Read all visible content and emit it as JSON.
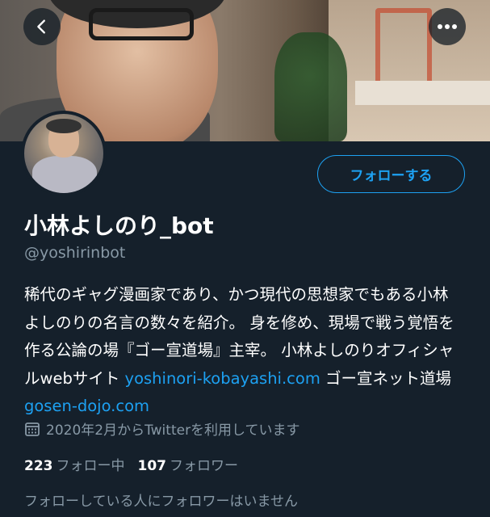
{
  "header": {
    "back_icon": "chevron-left-icon",
    "more_icon": "ellipsis-icon"
  },
  "profile": {
    "display_name": "小林よしのり_bot",
    "handle": "@yoshirinbot",
    "follow_label": "フォローする",
    "bio": {
      "text": "稀代のギャグ漫画家であり、かつ現代の思想家でもある小林よしのりの名言の数々を紹介。 身を修め、現場で戦う覚悟を作る公論の場『ゴー宣道場』主宰。 小林よしのりオフィシャルwebサイト ",
      "link1": "yoshinori-kobayashi.com",
      "middle": " ゴー宣ネット道場 ",
      "link2": "gosen-dojo.com"
    },
    "joined": "2020年2月からTwitterを利用しています",
    "following_count": "223",
    "following_label": "フォロー中",
    "followers_count": "107",
    "followers_label": "フォロワー",
    "no_mutual_followers": "フォローしている人にフォロワーはいません"
  },
  "colors": {
    "background": "#15202b",
    "accent": "#1da1f2",
    "secondary_text": "#8899a6"
  }
}
